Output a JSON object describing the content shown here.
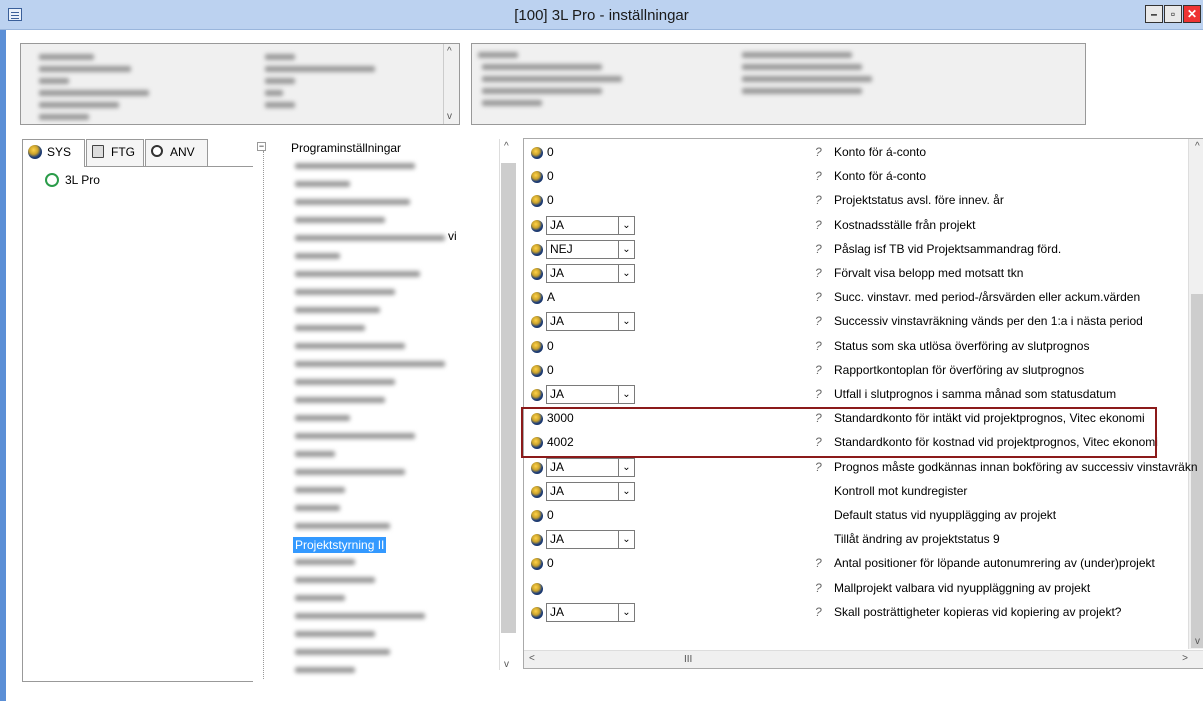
{
  "window": {
    "title": "[100]  3L Pro - inställningar"
  },
  "tabs": [
    {
      "label": "SYS",
      "icon": "globe-icon"
    },
    {
      "label": "FTG",
      "icon": "building-icon"
    },
    {
      "label": "ANV",
      "icon": "user-icon"
    }
  ],
  "left_tree": {
    "root": "3L Pro"
  },
  "mid_tree": {
    "header": "Programinställningar",
    "selected": "Projektstyrning II",
    "partial_text": "vi"
  },
  "grid": {
    "rows": [
      {
        "value": "0",
        "combo": false,
        "help": true,
        "desc": "Konto för á-conto"
      },
      {
        "value": "0",
        "combo": false,
        "help": true,
        "desc": "Konto för á-conto"
      },
      {
        "value": "0",
        "combo": false,
        "help": true,
        "desc": "Projektstatus avsl. före innev. år"
      },
      {
        "value": "JA",
        "combo": true,
        "help": true,
        "desc": "Kostnadsställe från projekt"
      },
      {
        "value": "NEJ",
        "combo": true,
        "help": true,
        "desc": "Påslag isf TB vid Projektsammandrag förd."
      },
      {
        "value": "JA",
        "combo": true,
        "help": true,
        "desc": "Förvalt visa belopp med motsatt tkn"
      },
      {
        "value": "A",
        "combo": false,
        "help": true,
        "desc": "Succ. vinstavr. med period-/årsvärden eller ackum.värden"
      },
      {
        "value": "JA",
        "combo": true,
        "help": true,
        "desc": "Successiv vinstavräkning vänds per den 1:a i nästa period"
      },
      {
        "value": "0",
        "combo": false,
        "help": true,
        "desc": "Status som ska utlösa överföring av slutprognos"
      },
      {
        "value": "0",
        "combo": false,
        "help": true,
        "desc": "Rapportkontoplan för överföring av slutprognos"
      },
      {
        "value": "JA",
        "combo": true,
        "help": true,
        "desc": "Utfall i slutprognos i samma månad som statusdatum"
      },
      {
        "value": "3000",
        "combo": false,
        "help": true,
        "desc": "Standardkonto för intäkt vid projektprognos, Vitec ekonomi"
      },
      {
        "value": "4002",
        "combo": false,
        "help": true,
        "desc": "Standardkonto för kostnad vid projektprognos, Vitec ekonomi"
      },
      {
        "value": "JA",
        "combo": true,
        "help": true,
        "desc": "Prognos måste godkännas innan bokföring av successiv vinstavräkn"
      },
      {
        "value": "JA",
        "combo": true,
        "help": false,
        "desc": "Kontroll mot kundregister"
      },
      {
        "value": "0",
        "combo": false,
        "help": false,
        "desc": "Default status vid nyupplägging av projekt"
      },
      {
        "value": "JA",
        "combo": true,
        "help": false,
        "desc": "Tillåt ändring av projektstatus 9"
      },
      {
        "value": "0",
        "combo": false,
        "help": true,
        "desc": "Antal positioner för löpande autonumrering av (under)projekt"
      },
      {
        "value": "",
        "combo": false,
        "help": true,
        "desc": "Mallprojekt valbara vid nyuppläggning av projekt"
      },
      {
        "value": "JA",
        "combo": true,
        "help": true,
        "desc": "Skall posträttigheter kopieras vid kopiering av projekt?"
      }
    ],
    "scroll_mark": "III"
  }
}
